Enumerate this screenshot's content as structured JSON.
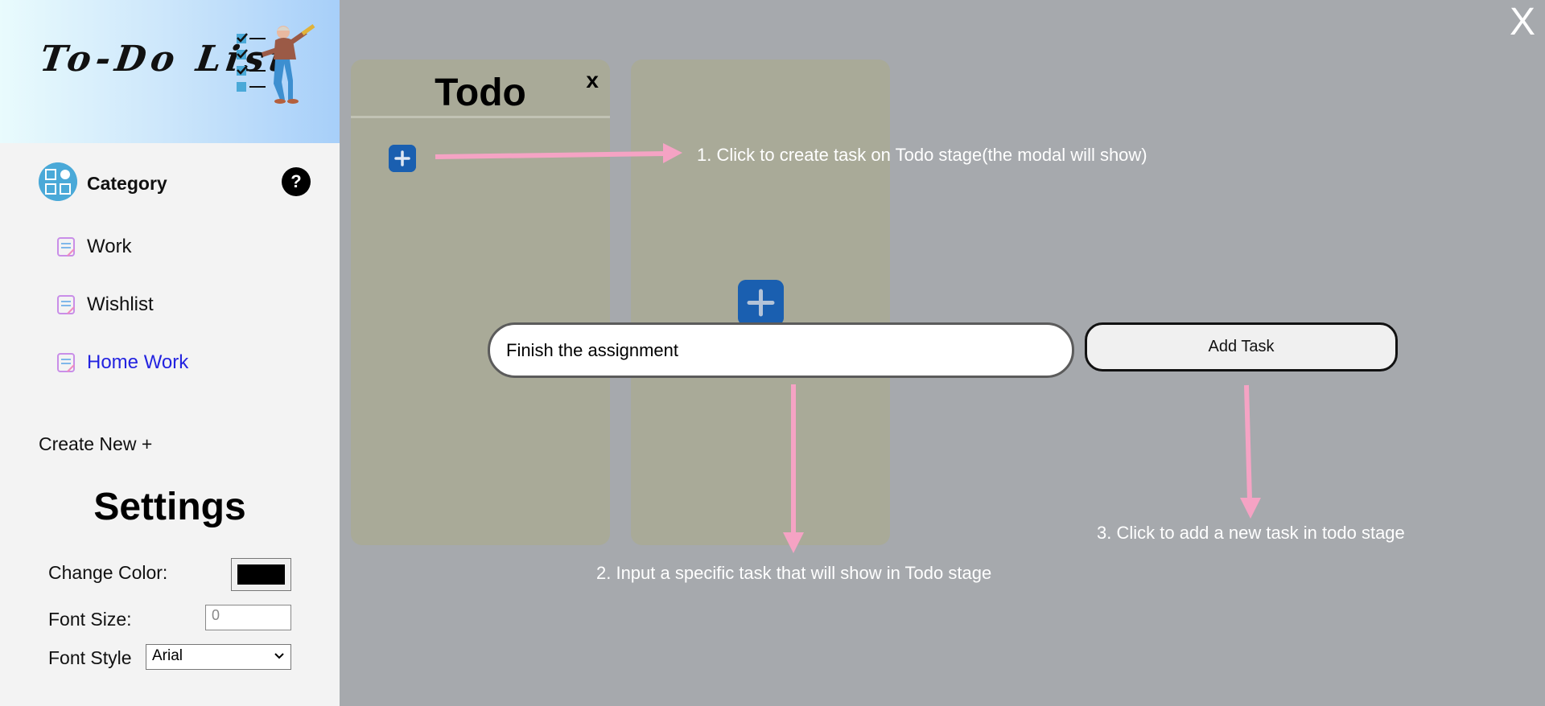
{
  "brand": {
    "title": "To-Do List",
    "illustration_icon": "person-with-checklist-illustration"
  },
  "sidebar": {
    "category_label": "Category",
    "help_label": "?",
    "items": [
      {
        "label": "Work",
        "icon": "note-icon",
        "active": false
      },
      {
        "label": "Wishlist",
        "icon": "note-icon",
        "active": false
      },
      {
        "label": "Home Work",
        "icon": "note-icon",
        "active": true
      }
    ],
    "create_new": "Create New +"
  },
  "settings": {
    "title": "Settings",
    "change_color_label": "Change Color:",
    "color_value": "#000000",
    "font_size_label": "Font Size:",
    "font_size_placeholder": "0",
    "font_style_label": "Font Style",
    "font_style_value": "Arial"
  },
  "board": {
    "title": "Todo",
    "close_label": "x"
  },
  "overlay": {
    "close_label": "X"
  },
  "modal": {
    "task_input_value": "Finish the assignment",
    "add_task_label": "Add Task"
  },
  "hints": {
    "step1": "1. Click to create task on Todo stage(the modal will show)",
    "step2": "2. Input a specific task that will show in Todo stage",
    "step3": "3. Click to add a new task in todo stage"
  },
  "colors": {
    "overlay_bg": "#a6a9ad",
    "board_bg": "#a9aa98",
    "accent_blue": "#1a5fb0",
    "arrow_pink": "#f5a3c4",
    "active_link": "#2323e0"
  }
}
